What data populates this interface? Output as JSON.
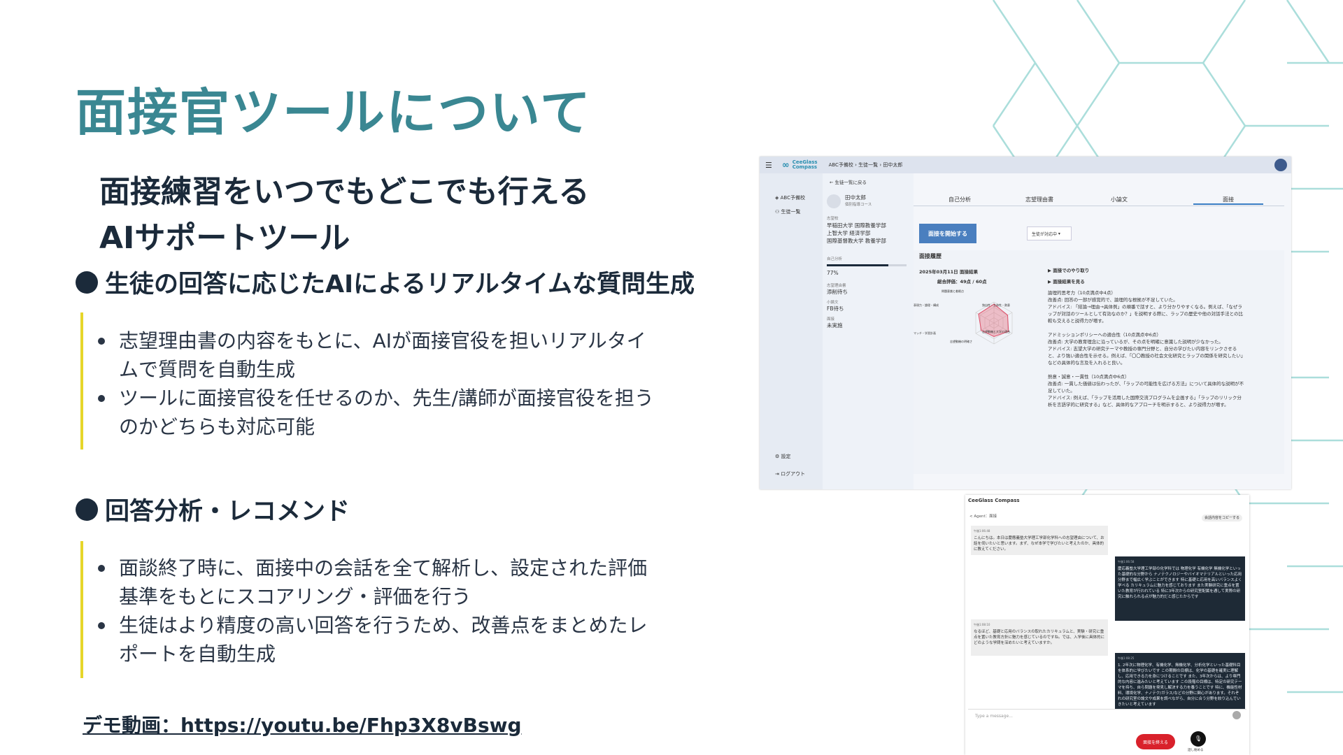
{
  "slide": {
    "title": "面接官ツールについて",
    "subtitle_line1": "面接練習をいつでもどこでも行える",
    "subtitle_line2": "AIサポートツール",
    "section1": {
      "heading": "生徒の回答に応じたAIによるリアルタイムな質問生成",
      "bullets": [
        "志望理由書の内容をもとに、AIが面接官役を担いリアルタイムで質問を自動生成",
        "ツールに面接官役を任せるのか、先生/講師が面接官役を担うのかどちらも対応可能"
      ]
    },
    "section2": {
      "heading": "回答分析・レコメンド",
      "bullets": [
        "面談終了時に、面接中の会話を全て解析し、設定された評価基準をもとにスコアリング・評価を行う",
        "生徒はより精度の高い回答を行うため、改善点をまとめたレポートを自動生成"
      ]
    },
    "demo_link": "デモ動画：https://youtu.be/Fhp3X8vBswg"
  },
  "colors": {
    "title": "#3a8792",
    "accent_bar": "#e6d62a",
    "text": "#1b2a3a",
    "primary_button": "#4a7fbf",
    "end_button": "#d9212b"
  },
  "app1": {
    "brand_line1": "CeeGlass",
    "brand_line2": "Compass",
    "breadcrumb": "ABC予備校 › 生徒一覧 › 田中太郎",
    "sidebar": {
      "item1": "ABC予備校",
      "item2": "生徒一覧",
      "settings": "設定",
      "logout": "ログアウト"
    },
    "back_link": "← 生徒一覧に戻る",
    "student_name": "田中太郎",
    "student_course": "個別指導コース",
    "label_target": "志望校",
    "target1": "早稲田大学 国際教養学部",
    "target2": "上智大学 経済学部",
    "target3": "国際基督教大学 教養学部",
    "label_self": "自己分析",
    "self_value": "77%",
    "label_motivation": "志望理由書",
    "motivation_value": "添削待ち",
    "label_essay": "小論文",
    "essay_value": "FB待ち",
    "label_interview": "面接",
    "interview_value": "未実施",
    "tab1": "自己分析",
    "tab2": "志望理由書",
    "tab3": "小論文",
    "tab4": "面接",
    "start_button": "面接を開始する",
    "select_value": "生徒が対応中",
    "history_title": "面接履歴",
    "result_date": "2025年03月11日 面接結果",
    "total_score": "総合評価：49点 / 60点",
    "toggle1": "▶ 面接でのやり取り",
    "toggle2": "▶ 面接結果を見る",
    "feedback": [
      "論理的思考力（10点満点中4点）",
      "改善点: 回答の一部が感覚的で、論理的な根拠が不足していた。",
      "アドバイス: 「結論→理由→具体例」の順番で話すと、より分かりやすくなる。例えば、「なぜラ",
      "ップが対話のツールとして有効なのか？」を説明する際に、ラップの歴史や他の対話手法との比",
      "較も交えると説得力が増す。",
      "",
      "アドミッションポリシーへの適合性（10点満点中6点）",
      "改善点: 大学の教育理念に沿っているが、その点を明確に意識した説明が少なかった。",
      "アドバイス: 志望大学の研究テーマや教授の専門分野と、自分の学びたい内容をリンクさせる",
      "と、より強い適合性を示せる。例えば、「〇〇教授の社会文化研究とラップの関係を研究したい」",
      "などの具体的な言及を入れると良い。",
      "",
      "熱意・誠意・一貫性（10点満点中6点）",
      "改善点: 一貫した価値は伝わったが、「ラップの可能性を広げる方法」について具体的な説明が不",
      "足していた。",
      "アドバイス: 例えば、「ラップを活用した国際交流プログラムを企画する」「ラップのリリック分",
      "析を言語学的に研究する」など、具体的なアプローチを明示すると、より説得力が増す。"
    ],
    "radar_labels": [
      "問題意識と着眼点",
      "独自性・主体性・熱意",
      "志望動機と大学の適合",
      "志望動機の明確さ",
      "マッチ・学習計画",
      "表現力・論理・構成"
    ]
  },
  "app2": {
    "title": "CeeGlass Compass",
    "sub": "< Agent：面接",
    "copy_button": "会話内容をコピーする",
    "messages": [
      {
        "side": "left",
        "meta": "午後1:06:48",
        "text": "こんにちは。本日は慶應義塾大学理工学部化学科への志望理由について、お話を伺いたいと思います。まず、なぜ本学で学びたいと考えたのか、具体的に教えてください。"
      },
      {
        "side": "right",
        "meta": "午後1:06:58",
        "text": "慶応義塾大学理工学部の化学科では 物理化学 有機化学 無機化学といった基礎的な分野から ナノテクノロジーやバイオマテリアルといった応用分野まで幅広く学ぶことができます 特に基礎と応用を高いバランスよく学べる カリキュラムに魅力を感じております また実験研究に重点を置いた教育が行われている 特に3年次からの研究室配属を通して実際の研究に触れられる点が魅力的だと感じたからです"
      },
      {
        "side": "left",
        "meta": "午後1:08:10",
        "text": "なるほど、基礎と応用のバランスの取れたカリキュラムと、実験・研究に重点を置いた教育方針に魅力を感じているのですね。では、入学後に具体的にどのような学問を深めたいと考えていますか。"
      },
      {
        "side": "right",
        "meta": "午後1:08:25",
        "text": "1. 2年次に物理化学、有機化学、無機化学、分析化学といった基礎科目を体系的に学びたいです この期間の目標は、化学の基礎を確実に理解し、応用できる力を身につけることです また、3年次からは、より専門的な内容に進みたいと考えています この段階の目標は、特定の研究テーマを持ち、自ら問題を発見し解決する力を養うことです 特に、機能性材料、環境化学、ナノテク/ガラス/などの分野に関心があります。それぞれの研究室の論文や成果を調べながら、自分に合う分野を絞り込んでいきたいと考えています"
      }
    ],
    "input_placeholder": "Type a message...",
    "end_button": "面接を終える",
    "mic_label": "話し始める"
  }
}
